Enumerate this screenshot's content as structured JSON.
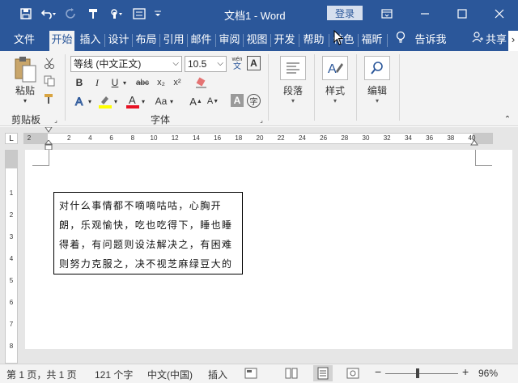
{
  "titlebar": {
    "doc_title": "文档1 - Word",
    "login_label": "登录"
  },
  "tabs": [
    {
      "label": "文件"
    },
    {
      "label": "开始"
    },
    {
      "label": "插入"
    },
    {
      "label": "设计"
    },
    {
      "label": "布局"
    },
    {
      "label": "引用"
    },
    {
      "label": "邮件"
    },
    {
      "label": "审阅"
    },
    {
      "label": "视图"
    },
    {
      "label": "开发"
    },
    {
      "label": "帮助"
    },
    {
      "label": "特色"
    },
    {
      "label": "福昕"
    },
    {
      "label": "告诉我"
    },
    {
      "label": "共享"
    }
  ],
  "ribbon": {
    "clipboard": {
      "paste_label": "粘贴",
      "group_label": "剪贴板"
    },
    "font": {
      "font_name": "等线 (中文正文)",
      "font_size": "10.5",
      "group_label": "字体",
      "bold": "B",
      "italic": "I",
      "underline": "U",
      "strike": "abc",
      "subscript": "x₂",
      "superscript": "x²",
      "change_case": "Aa",
      "grow": "A",
      "shrink": "A",
      "char_shade": "A",
      "enclose": "字",
      "phonetic_top": "wén",
      "phonetic_bottom": "文",
      "border_char": "A"
    },
    "paragraph": {
      "label": "段落"
    },
    "styles": {
      "label": "样式"
    },
    "editing": {
      "label": "编辑"
    }
  },
  "ruler": {
    "ticks": [
      "2",
      "2",
      "4",
      "6",
      "8",
      "10",
      "12",
      "14",
      "16",
      "18",
      "20",
      "22",
      "24",
      "26",
      "28",
      "30",
      "32",
      "34",
      "36",
      "38",
      "40"
    ],
    "corner": "L"
  },
  "document": {
    "textbox_lines": [
      "对什么事情都不嘀嘀咕咕，心胸开",
      "朗，乐观愉快，吃也吃得下，睡也睡",
      "得着，有问题则设法解决之，有困难",
      "则努力克服之，决不视芝麻绿豆大的"
    ],
    "vruler_ticks": [
      "1",
      "2",
      "3",
      "4",
      "5",
      "6",
      "7",
      "8"
    ]
  },
  "statusbar": {
    "page": "第 1 页，共 1 页",
    "words": "121 个字",
    "language": "中文(中国)",
    "mode": "插入",
    "zoom": "96%",
    "zoom_minus": "−",
    "zoom_plus": "+"
  },
  "colors": {
    "brand": "#2b579a",
    "highlight": "#ffff00",
    "font_color": "#e81123"
  }
}
